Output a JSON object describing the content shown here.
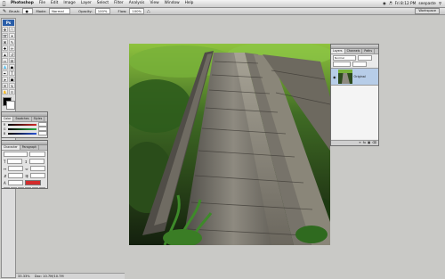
{
  "menubar": {
    "app_name": "Photoshop",
    "items": [
      "File",
      "Edit",
      "Image",
      "Layer",
      "Select",
      "Filter",
      "Analysis",
      "View",
      "Window",
      "Help"
    ],
    "clock": "Fri 8:12 PM",
    "user": "seepaste"
  },
  "options_bar": {
    "brush_label": "Brush:",
    "mode_label": "Mode:",
    "mode_value": "Normal",
    "opacity_label": "Opacity:",
    "opacity_value": "100%",
    "flow_label": "Flow:",
    "flow_value": "100%",
    "workspace_label": "Workspace"
  },
  "toolbox": {
    "logo": "Ps",
    "tools": [
      "move-tool",
      "marquee-tool",
      "lasso-tool",
      "magic-wand-tool",
      "crop-tool",
      "slice-tool",
      "healing-brush-tool",
      "brush-tool",
      "clone-stamp-tool",
      "history-brush-tool",
      "eraser-tool",
      "gradient-tool",
      "blur-tool",
      "dodge-tool",
      "pen-tool",
      "type-tool",
      "path-selection-tool",
      "shape-tool",
      "notes-tool",
      "eyedropper-tool",
      "hand-tool",
      "zoom-tool"
    ]
  },
  "color_panel": {
    "tabs": [
      "Color",
      "Swatches",
      "Styles"
    ],
    "channels": [
      {
        "label": "R",
        "color": "#d42b2b"
      },
      {
        "label": "G",
        "color": "#2bb043"
      },
      {
        "label": "B",
        "color": "#2b55d4"
      }
    ]
  },
  "character_panel": {
    "tabs": [
      "Character",
      "Paragraph"
    ],
    "text_color": "#d42b2b"
  },
  "layers_panel": {
    "tabs": [
      "Layers",
      "Channels",
      "Paths"
    ],
    "blend_mode": "Normal",
    "layer_name": "Original",
    "highlight_color": "#b7cde8"
  },
  "document": {
    "image_name": "wooden-bridge-photo"
  },
  "status": {
    "zoom": "33.33%",
    "doc_info": "Doc: 10.7M/10.7M"
  }
}
